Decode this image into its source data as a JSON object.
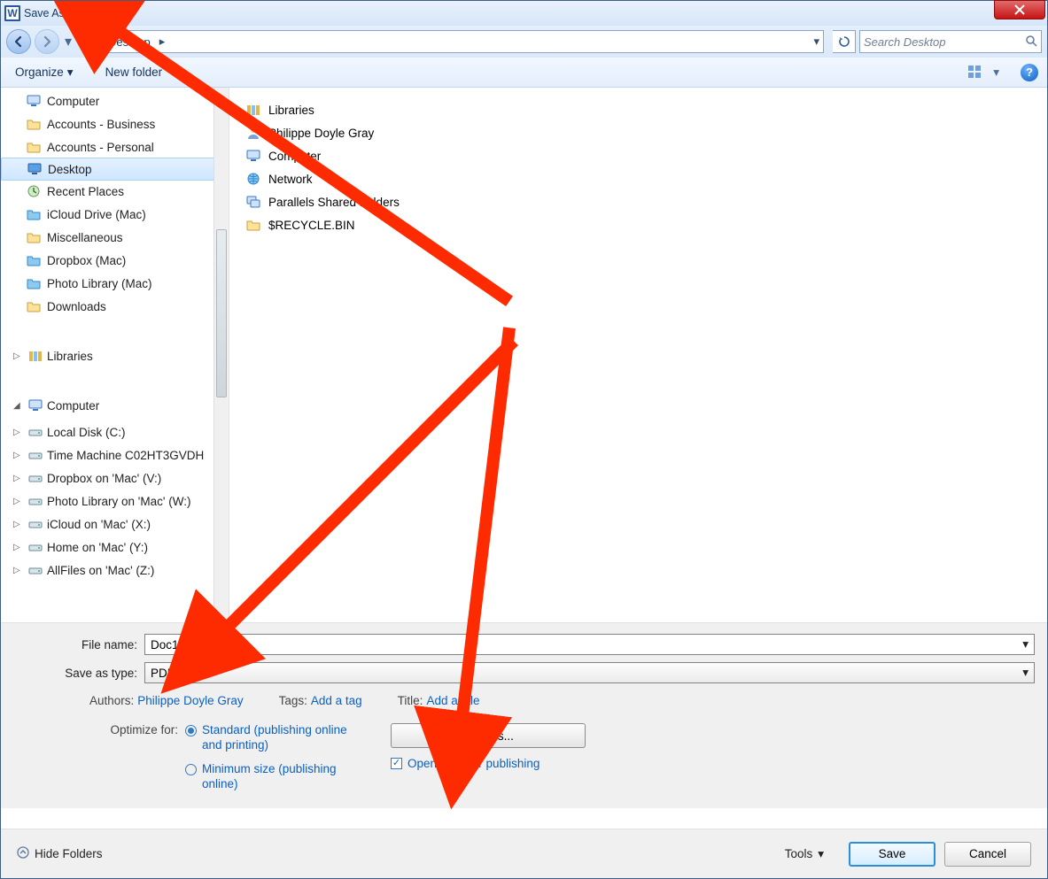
{
  "title": "Save As",
  "breadcrumb": {
    "segment": "Desktop"
  },
  "search": {
    "placeholder": "Search Desktop"
  },
  "toolbar": {
    "organize": "Organize",
    "newfolder": "New folder"
  },
  "favorites": [
    {
      "label": "Computer",
      "icon": "computer"
    },
    {
      "label": "Accounts - Business",
      "icon": "folder"
    },
    {
      "label": "Accounts - Personal",
      "icon": "folder"
    },
    {
      "label": "Desktop",
      "icon": "monitor",
      "selected": true
    },
    {
      "label": "Recent Places",
      "icon": "recent"
    },
    {
      "label": "iCloud Drive (Mac)",
      "icon": "bluefolder"
    },
    {
      "label": "Miscellaneous",
      "icon": "folder"
    },
    {
      "label": "Dropbox (Mac)",
      "icon": "bluefolder"
    },
    {
      "label": "Photo Library (Mac)",
      "icon": "bluefolder"
    },
    {
      "label": "Downloads",
      "icon": "folder"
    }
  ],
  "tree1": {
    "label": "Libraries"
  },
  "tree2": {
    "label": "Computer",
    "children": [
      "Local Disk (C:)",
      "Time Machine C02HT3GVDH",
      "Dropbox on 'Mac' (V:)",
      "Photo Library on 'Mac' (W:)",
      "iCloud on 'Mac' (X:)",
      "Home on 'Mac' (Y:)",
      "AllFiles on 'Mac' (Z:)"
    ]
  },
  "content": [
    {
      "label": "Libraries",
      "icon": "libraries"
    },
    {
      "label": "Philippe Doyle Gray",
      "icon": "user"
    },
    {
      "label": "Computer",
      "icon": "computer"
    },
    {
      "label": "Network",
      "icon": "network"
    },
    {
      "label": "Parallels Shared Folders",
      "icon": "share"
    },
    {
      "label": "$RECYCLE.BIN",
      "icon": "folder"
    }
  ],
  "form": {
    "filename_label": "File name:",
    "filename_value": "Doc1",
    "type_label": "Save as type:",
    "type_value": "PDF",
    "authors_label": "Authors:",
    "authors_value": "Philippe Doyle Gray",
    "tags_label": "Tags:",
    "tags_value": "Add a tag",
    "title_label": "Title:",
    "title_value": "Add a title",
    "optimize_label": "Optimize for:",
    "radio1": "Standard (publishing online and printing)",
    "radio2": "Minimum size (publishing online)",
    "options_btn": "Options...",
    "open_after": "Open file after publishing"
  },
  "footer": {
    "hide": "Hide Folders",
    "tools": "Tools",
    "save": "Save",
    "cancel": "Cancel"
  }
}
